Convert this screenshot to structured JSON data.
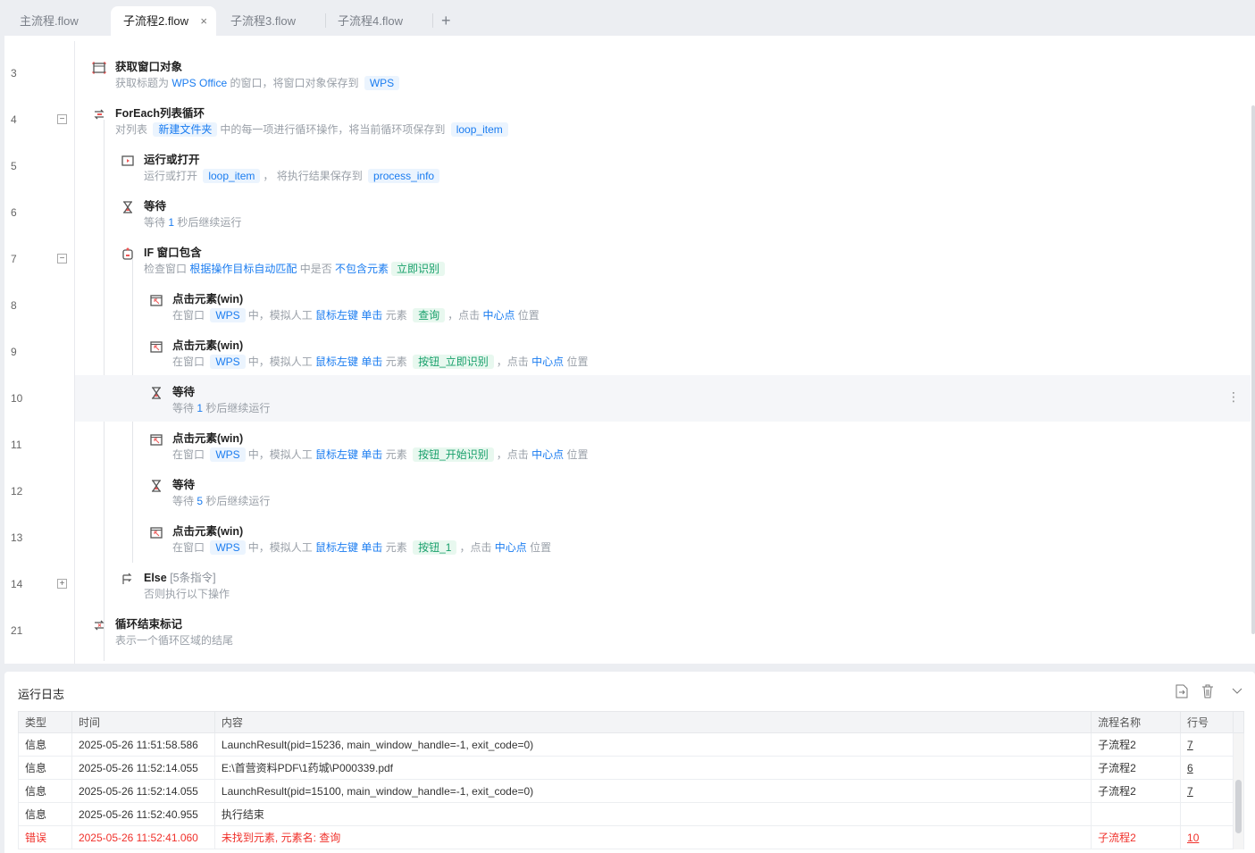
{
  "tabs": [
    {
      "label": "主流程.flow"
    },
    {
      "label": "子流程2.flow",
      "active": true
    },
    {
      "label": "子流程3.flow"
    },
    {
      "label": "子流程4.flow"
    }
  ],
  "tab_close": "×",
  "tab_add": "+",
  "colors": {
    "link": "#1a7cf0",
    "error": "#f0302a",
    "green": "#18a06b"
  },
  "steps": [
    {
      "line": "3",
      "level": 0,
      "fold": "",
      "icon": "window-icon",
      "title": "获取窗口对象",
      "desc": [
        {
          "t": "获取标题为 "
        },
        {
          "t": "WPS Office",
          "k": "link"
        },
        {
          "t": " 的窗口，将窗口对象保存到 "
        },
        {
          "t": "WPS",
          "k": "tag"
        }
      ]
    },
    {
      "line": "4",
      "level": 0,
      "fold": "−",
      "icon": "loop-icon",
      "title": "ForEach列表循环",
      "desc": [
        {
          "t": "对列表 "
        },
        {
          "t": "新建文件夹",
          "k": "tag"
        },
        {
          "t": "中的每一项进行循环操作，将当前循环项保存到 "
        },
        {
          "t": "loop_item",
          "k": "tag"
        }
      ]
    },
    {
      "line": "5",
      "level": 1,
      "fold": "",
      "icon": "run-icon",
      "title": "运行或打开",
      "desc": [
        {
          "t": "运行或打开 "
        },
        {
          "t": "loop_item",
          "k": "tag"
        },
        {
          "t": "， 将执行结果保存到 "
        },
        {
          "t": "process_info",
          "k": "tag"
        }
      ]
    },
    {
      "line": "6",
      "level": 1,
      "fold": "",
      "icon": "hourglass-icon",
      "title": "等待",
      "desc": [
        {
          "t": "等待 "
        },
        {
          "t": "1",
          "k": "link"
        },
        {
          "t": " 秒后继续运行"
        }
      ]
    },
    {
      "line": "7",
      "level": 1,
      "fold": "−",
      "icon": "if-window-icon",
      "title": "IF 窗口包含",
      "desc": [
        {
          "t": "检查窗口 "
        },
        {
          "t": "根据操作目标自动匹配",
          "k": "link"
        },
        {
          "t": " 中是否 "
        },
        {
          "t": "不包含元素",
          "k": "link"
        },
        {
          "t": "立即识别",
          "k": "tagg"
        }
      ]
    },
    {
      "line": "8",
      "level": 2,
      "fold": "",
      "icon": "click-element-icon",
      "title": "点击元素(win)",
      "desc": [
        {
          "t": "在窗口 "
        },
        {
          "t": "WPS",
          "k": "tag"
        },
        {
          "t": "中，模拟人工 "
        },
        {
          "t": "鼠标左键",
          "k": "link"
        },
        {
          "t": " "
        },
        {
          "t": "单击",
          "k": "link"
        },
        {
          "t": " 元素 "
        },
        {
          "t": "查询",
          "k": "tagg"
        },
        {
          "t": "，点击 "
        },
        {
          "t": "中心点",
          "k": "link"
        },
        {
          "t": " 位置"
        }
      ]
    },
    {
      "line": "9",
      "level": 2,
      "fold": "",
      "icon": "click-element-icon",
      "title": "点击元素(win)",
      "desc": [
        {
          "t": "在窗口 "
        },
        {
          "t": "WPS",
          "k": "tag"
        },
        {
          "t": "中，模拟人工 "
        },
        {
          "t": "鼠标左键",
          "k": "link"
        },
        {
          "t": " "
        },
        {
          "t": "单击",
          "k": "link"
        },
        {
          "t": " 元素 "
        },
        {
          "t": "按钮_立即识别",
          "k": "tagg"
        },
        {
          "t": "，点击 "
        },
        {
          "t": "中心点",
          "k": "link"
        },
        {
          "t": " 位置"
        }
      ]
    },
    {
      "line": "10",
      "level": 2,
      "fold": "",
      "icon": "hourglass-icon",
      "title": "等待",
      "highlight": true,
      "desc": [
        {
          "t": "等待 "
        },
        {
          "t": "1",
          "k": "link"
        },
        {
          "t": " 秒后继续运行"
        }
      ]
    },
    {
      "line": "11",
      "level": 2,
      "fold": "",
      "icon": "click-element-icon",
      "title": "点击元素(win)",
      "desc": [
        {
          "t": "在窗口 "
        },
        {
          "t": "WPS",
          "k": "tag"
        },
        {
          "t": "中，模拟人工 "
        },
        {
          "t": "鼠标左键",
          "k": "link"
        },
        {
          "t": " "
        },
        {
          "t": "单击",
          "k": "link"
        },
        {
          "t": " 元素 "
        },
        {
          "t": "按钮_开始识别",
          "k": "tagg"
        },
        {
          "t": "，点击 "
        },
        {
          "t": "中心点",
          "k": "link"
        },
        {
          "t": " 位置"
        }
      ]
    },
    {
      "line": "12",
      "level": 2,
      "fold": "",
      "icon": "hourglass-icon",
      "title": "等待",
      "desc": [
        {
          "t": "等待 "
        },
        {
          "t": "5",
          "k": "link"
        },
        {
          "t": " 秒后继续运行"
        }
      ]
    },
    {
      "line": "13",
      "level": 2,
      "fold": "",
      "icon": "click-element-icon",
      "title": "点击元素(win)",
      "desc": [
        {
          "t": "在窗口 "
        },
        {
          "t": "WPS",
          "k": "tag"
        },
        {
          "t": "中，模拟人工 "
        },
        {
          "t": "鼠标左键",
          "k": "link"
        },
        {
          "t": " "
        },
        {
          "t": "单击",
          "k": "link"
        },
        {
          "t": " 元素 "
        },
        {
          "t": "按钮_1",
          "k": "tagg"
        },
        {
          "t": "，点击 "
        },
        {
          "t": "中心点",
          "k": "link"
        },
        {
          "t": " 位置"
        }
      ]
    },
    {
      "line": "14",
      "level": 1,
      "fold": "+",
      "icon": "else-branch-icon",
      "title": "Else",
      "title_sub": "[5条指令]",
      "desc": [
        {
          "t": "否则执行以下操作"
        }
      ]
    },
    {
      "line": "21",
      "level": 0,
      "fold": "",
      "icon": "loop-end-icon",
      "title": "循环结束标记",
      "desc": [
        {
          "t": "表示一个循环区域的结尾"
        }
      ]
    }
  ],
  "kebab": "⋮",
  "log": {
    "title": "运行日志",
    "columns": [
      "类型",
      "时间",
      "内容",
      "流程名称",
      "行号"
    ],
    "rows": [
      {
        "type": "信息",
        "time": "2025-05-26 11:51:58.586",
        "content": "LaunchResult(pid=15236, main_window_handle=-1, exit_code=0)",
        "flow": "子流程2",
        "line": "7"
      },
      {
        "type": "信息",
        "time": "2025-05-26 11:52:14.055",
        "content": "E:\\首营资料PDF\\1药城\\P000339.pdf",
        "flow": "子流程2",
        "line": "6"
      },
      {
        "type": "信息",
        "time": "2025-05-26 11:52:14.055",
        "content": "LaunchResult(pid=15100, main_window_handle=-1, exit_code=0)",
        "flow": "子流程2",
        "line": "7"
      },
      {
        "type": "信息",
        "time": "2025-05-26 11:52:40.955",
        "content": "执行结束",
        "flow": "",
        "line": ""
      },
      {
        "type": "错误",
        "time": "2025-05-26 11:52:41.060",
        "content": "未找到元素, 元素名: 查询",
        "flow": "子流程2",
        "line": "10",
        "error": true
      }
    ]
  }
}
